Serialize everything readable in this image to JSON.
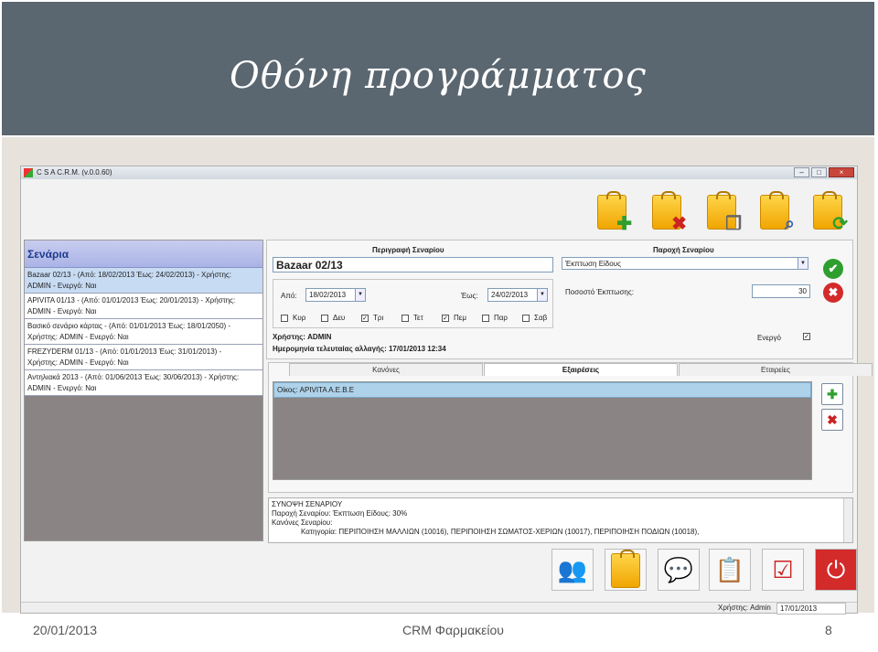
{
  "slide": {
    "title": "Οθόνη προγράμματος",
    "footer_date": "20/01/2013",
    "footer_center": "CRM Φαρμακείου",
    "page_number": "8"
  },
  "window": {
    "title": "C S A C.R.M. (v.0.0.60)",
    "buttons": {
      "minimize": "–",
      "maximize": "□",
      "close": "×"
    }
  },
  "toolbar": [
    {
      "name": "add-scenario-button",
      "overlay": "✚",
      "overlay_color": "#2e9e2e"
    },
    {
      "name": "delete-scenario-button",
      "overlay": "✖",
      "overlay_color": "#cc2222"
    },
    {
      "name": "copy-scenario-button",
      "overlay": "❐",
      "overlay_color": "#666666"
    },
    {
      "name": "search-scenario-button",
      "overlay": "⌕",
      "overlay_color": "#3a62b0"
    },
    {
      "name": "refresh-scenario-button",
      "overlay": "⟳",
      "overlay_color": "#2e9e2e"
    }
  ],
  "scenarios": {
    "header": "Σενάρια",
    "items": [
      {
        "line1": "Bazaar 02/13 - (Από: 18/02/2013 Έως: 24/02/2013) - Χρήστης:",
        "line2": "ADMIN - Ενεργό: Ναι",
        "selected": true
      },
      {
        "line1": "APIVITA 01/13 - (Από: 01/01/2013 Έως: 20/01/2013) - Χρήστης:",
        "line2": "ADMIN - Ενεργό: Ναι",
        "selected": false
      },
      {
        "line1": "Βασικό σενάριο κάρτας - (Από: 01/01/2013 Έως: 18/01/2050) -",
        "line2": "Χρήστης: ADMIN - Ενεργό: Ναι",
        "selected": false
      },
      {
        "line1": "FREZYDERM 01/13 - (Από: 01/01/2013 Έως: 31/01/2013) -",
        "line2": "Χρήστης: ADMIN - Ενεργό: Ναι",
        "selected": false
      },
      {
        "line1": "Αντηλιακά 2013 - (Από: 01/06/2013 Έως: 30/06/2013) - Χρήστης:",
        "line2": "ADMIN - Ενεργό: Ναι",
        "selected": false
      }
    ]
  },
  "description": {
    "header": "Περιγραφή Σεναρίου",
    "name_value": "Bazaar 02/13",
    "from_label": "Από:",
    "from_value": "18/02/2013",
    "to_label": "Έως:",
    "to_value": "24/02/2013",
    "days": [
      {
        "label": "Κυρ",
        "checked": false
      },
      {
        "label": "Δευ",
        "checked": false
      },
      {
        "label": "Τρι",
        "checked": true
      },
      {
        "label": "Τετ",
        "checked": false
      },
      {
        "label": "Πεμ",
        "checked": true
      },
      {
        "label": "Παρ",
        "checked": false
      },
      {
        "label": "Σαβ",
        "checked": false
      }
    ],
    "user_line": "Χρήστης: ADMIN",
    "last_change_line": "Ημερομηνία τελευταίας αλλαγής: 17/01/2013 12:34"
  },
  "provision": {
    "header": "Παροχή Σεναρίου",
    "type_value": "Έκπτωση Είδους",
    "percent_label": "Ποσοστό Έκπτωσης:",
    "percent_value": "30",
    "active_label": "Ενεργό",
    "active_checked": true
  },
  "actions": {
    "ok_icon": "✔",
    "cancel_icon": "✖",
    "ok_color": "#2e9e2e",
    "cancel_color": "#d32a2a"
  },
  "tabs": {
    "items": [
      {
        "label": "Κανόνες",
        "active": false
      },
      {
        "label": "Εξαιρέσεις",
        "active": true
      },
      {
        "label": "Εταιρείες",
        "active": false
      }
    ],
    "exception_row": "Οίκος: APIVITA A.E.B.E",
    "add_icon": "✚",
    "remove_icon": "✖"
  },
  "summary": {
    "lines": [
      {
        "text": "ΣΥΝΟΨΗ ΣΕΝΑΡΙΟΥ",
        "indent": false
      },
      {
        "text": "Παροχή Σεναρίου: Έκπτωση Είδους: 30%",
        "indent": false
      },
      {
        "text": "Κανόνες Σεναρίου:",
        "indent": false
      },
      {
        "text": "Κατηγορία: ΠΕΡΙΠΟΙΗΣΗ ΜΑΛΛΙΩΝ (10016), ΠΕΡΙΠΟΙΗΣΗ ΣΩΜΑΤΟΣ-ΧΕΡΙΩΝ (10017), ΠΕΡΙΠΟΙΗΣΗ ΠΟΔΙΩΝ (10018),",
        "indent": true
      }
    ]
  },
  "bottom_toolbar": [
    {
      "name": "customers-button",
      "glyph": "👥",
      "color": "#3a62b0"
    },
    {
      "name": "scenarios-button",
      "glyph": "",
      "color": "#f0a500"
    },
    {
      "name": "messages-button",
      "glyph": "💬",
      "color": "#2e9e2e"
    },
    {
      "name": "cards-button",
      "glyph": "📋",
      "color": "#6a6a6a"
    },
    {
      "name": "tasks-button",
      "glyph": "☑",
      "color": "#cc2222"
    },
    {
      "name": "power-button",
      "glyph": "⏻",
      "color": "#d32a2a"
    }
  ],
  "statusbar": {
    "user": "Χρήστης: Admin",
    "date": "17/01/2013"
  }
}
